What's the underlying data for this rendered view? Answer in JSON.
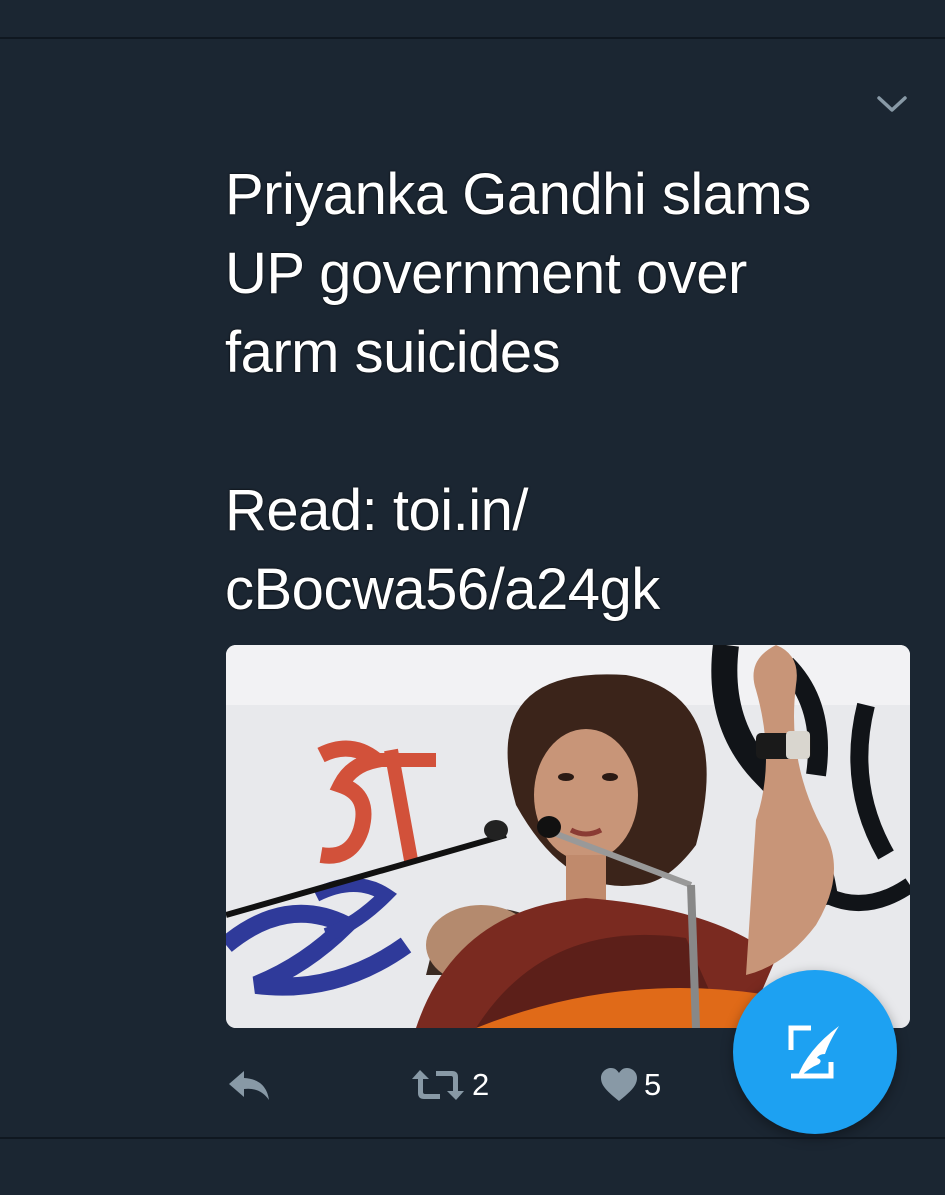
{
  "tweet": {
    "text": "Priyanka Gandhi slams\nUP government over\nfarm suicides\n\nRead: toi.in/\ncBocwa56/a24gk",
    "media_label": "Photo",
    "actions": {
      "reply_icon": "reply-icon",
      "retweet_icon": "retweet-icon",
      "retweet_count": "2",
      "like_icon": "heart-icon",
      "like_count": "5"
    },
    "menu_icon": "chevron-down-icon"
  },
  "compose_button": {
    "icon": "compose-tweet-icon"
  },
  "colors": {
    "background": "#1b2632",
    "divider": "#0f1720",
    "accent": "#1da1f2",
    "icon": "#8899a6"
  }
}
